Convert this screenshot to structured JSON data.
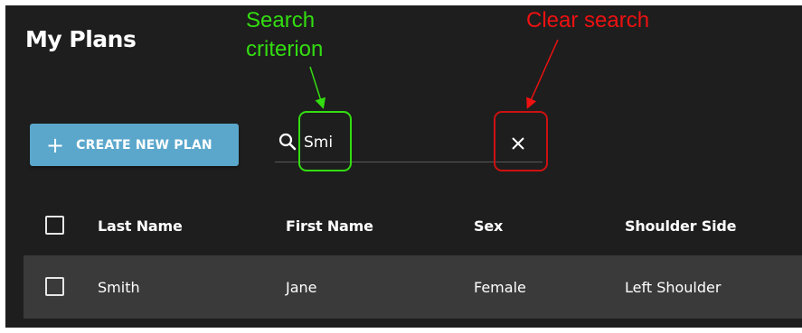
{
  "page": {
    "title": "My Plans"
  },
  "toolbar": {
    "create_plus": "+",
    "create_label": "CREATE NEW PLAN",
    "search_value": "Smi",
    "search_icon": "search-icon",
    "clear_icon": "close-icon"
  },
  "table": {
    "columns": [
      "Last Name",
      "First Name",
      "Sex",
      "Shoulder Side"
    ],
    "rows": [
      {
        "last_name": "Smith",
        "first_name": "Jane",
        "sex": "Female",
        "shoulder_side": "Left Shoulder"
      }
    ]
  },
  "annotations": {
    "search_label_line1": "Search",
    "search_label_line2": "criterion",
    "clear_label": "Clear search",
    "search_color": "#33dd11",
    "clear_color": "#ee1111"
  },
  "colors": {
    "background": "#1e1e1e",
    "button": "#5ba7cc",
    "row_highlight": "#3a3a3a"
  }
}
